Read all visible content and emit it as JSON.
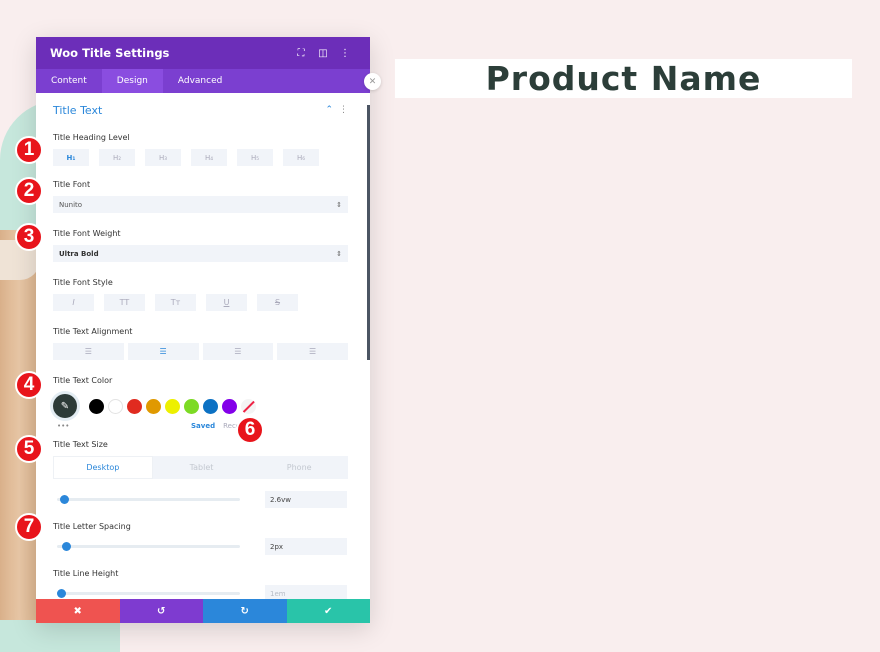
{
  "panel": {
    "title": "Woo Title Settings",
    "header_icons": [
      "fullscreen-icon",
      "split-view-icon",
      "more-icon"
    ],
    "tabs": [
      {
        "label": "Content",
        "active": false
      },
      {
        "label": "Design",
        "active": true
      },
      {
        "label": "Advanced",
        "active": false
      }
    ],
    "section": {
      "title": "Title Text",
      "expanded": true
    },
    "heading_level": {
      "label": "Title Heading Level",
      "options": [
        "H₁",
        "H₂",
        "H₃",
        "H₄",
        "H₅",
        "H₆"
      ],
      "selected": 0
    },
    "font": {
      "label": "Title Font",
      "value": "Nunito"
    },
    "font_weight": {
      "label": "Title Font Weight",
      "value": "Ultra Bold"
    },
    "font_style": {
      "label": "Title Font Style",
      "options": [
        "I",
        "TT",
        "Tт",
        "U",
        "S"
      ]
    },
    "alignment": {
      "label": "Title Text Alignment",
      "options": [
        "left",
        "center",
        "right",
        "justify"
      ],
      "selected": 1
    },
    "color": {
      "label": "Title Text Color",
      "current": "#2d3b38",
      "swatches": [
        "#000000",
        "#ffffff",
        "#e02b20",
        "#e09900",
        "#edf000",
        "#7cda24",
        "#0c71c3",
        "#8300e9"
      ],
      "more": "•••",
      "saved_label": "Saved",
      "recent_label": "Recent"
    },
    "text_size": {
      "label": "Title Text Size",
      "devices": [
        "Desktop",
        "Tablet",
        "Phone"
      ],
      "active_device": 0,
      "value": "2.6vw",
      "slider_fraction": 0.02
    },
    "letter_spacing": {
      "label": "Title Letter Spacing",
      "value": "2px",
      "slider_fraction": 0.03
    },
    "line_height": {
      "label": "Title Line Height",
      "value": "1em",
      "slider_fraction": 0.0
    },
    "footer": {
      "cancel": "✖",
      "undo": "↺",
      "redo": "↻",
      "save": "✔",
      "colors": {
        "cancel": "#ef5350",
        "undo": "#7e3bd0",
        "redo": "#2b87da",
        "save": "#29c4a9"
      }
    }
  },
  "preview": {
    "title": "Product Name"
  },
  "markers": [
    "1",
    "2",
    "3",
    "4",
    "5",
    "6",
    "7"
  ]
}
